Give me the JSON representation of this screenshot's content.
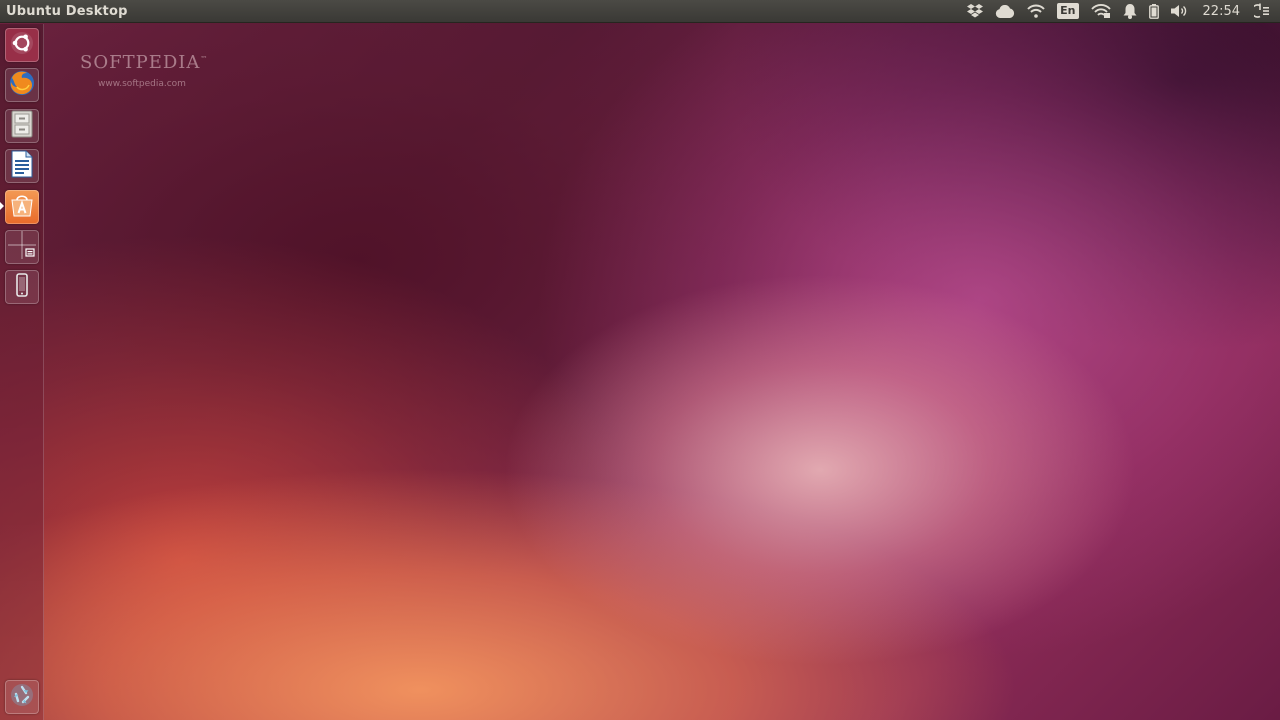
{
  "top_panel": {
    "window_title": "Ubuntu Desktop",
    "indicators": {
      "dropbox_icon": "dropbox-icon",
      "cloud_icon": "cloud-icon",
      "wifi_icon": "wifi-icon",
      "keyboard_layout": "En",
      "network_icon": "wireless-network-icon",
      "notification_icon": "bell-icon",
      "battery_icon": "battery-icon",
      "volume_icon": "speaker-icon",
      "clock": "22:54",
      "session_icon": "power-gear-icon"
    }
  },
  "launcher": {
    "items": [
      {
        "name": "dash-home",
        "icon": "ubuntu-logo-icon"
      },
      {
        "name": "firefox",
        "icon": "firefox-icon"
      },
      {
        "name": "files",
        "icon": "file-cabinet-icon"
      },
      {
        "name": "libreoffice-writer",
        "icon": "document-icon"
      },
      {
        "name": "ubuntu-software-center",
        "icon": "software-center-icon",
        "active": true
      },
      {
        "name": "workspace-switcher",
        "icon": "workspace-switcher-icon"
      },
      {
        "name": "ubuntu-one-phone",
        "icon": "phone-icon"
      },
      {
        "name": "trash",
        "icon": "trash-icon"
      }
    ]
  },
  "watermark": {
    "logo_text": "SOFTPEDIA",
    "trademark": "™",
    "url": "www.softpedia.com"
  },
  "colors": {
    "panel_bg": "#3c3b37",
    "panel_text": "#dfdbd2",
    "launcher_accent": "#e86a2a"
  }
}
